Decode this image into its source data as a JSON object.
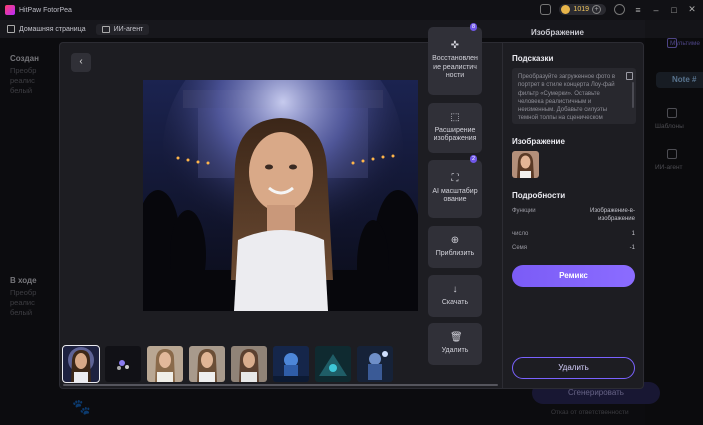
{
  "app": {
    "title": "HitPaw FotorPea"
  },
  "titlebar": {
    "credits": "1019"
  },
  "nav": {
    "home": "Домашняя страница",
    "ai_tab": "ИИ-агент"
  },
  "background": {
    "block1_title": "Создан",
    "block1_lines": [
      "Преобр",
      "реалис",
      "белый"
    ],
    "block2_title": "В ходе",
    "block2_lines": [
      "Преобр",
      "реалис",
      "белый"
    ],
    "right_title": "Изображение",
    "side_items": [
      "Мультиме",
      "Шаблоны",
      "ИИ-агент"
    ],
    "note": "Note #",
    "generate_label": "Сгенерировать",
    "disclaimer": "Отказ от ответственности"
  },
  "tools": [
    {
      "label": "Восстановление реалистичности",
      "icon": "restore-icon"
    },
    {
      "label": "Расширение изображения",
      "icon": "expand-icon"
    },
    {
      "label": "AI масштабирование",
      "icon": "upscale-icon"
    },
    {
      "label": "Приблизить",
      "icon": "zoom-in-icon"
    },
    {
      "label": "Скачать",
      "icon": "download-icon"
    },
    {
      "label": "Удалить",
      "icon": "trash-icon"
    }
  ],
  "badges": {
    "restore": "8",
    "upscale": "2"
  },
  "panel": {
    "prompts_title": "Подсказки",
    "prompt_text": "Преобразуйте загруженное фото в портрет в стиле концерта Лоу-фай фильтр «Сумерки». Оставьте человека реалистичным и неизменным. Добавьте силуэты темной толпы на сценическом",
    "image_title": "Изображение",
    "details_title": "Подробности",
    "details": [
      {
        "label": "Функции",
        "value": "Изображение-в-изображение"
      },
      {
        "label": "число",
        "value": "1"
      },
      {
        "label": "Семя",
        "value": "-1"
      }
    ],
    "remix_label": "Ремикс",
    "delete_label": "Удалить"
  },
  "colors": {
    "accent": "#7b5cf6",
    "background": "#17171c",
    "panel": "#1d1d22"
  }
}
